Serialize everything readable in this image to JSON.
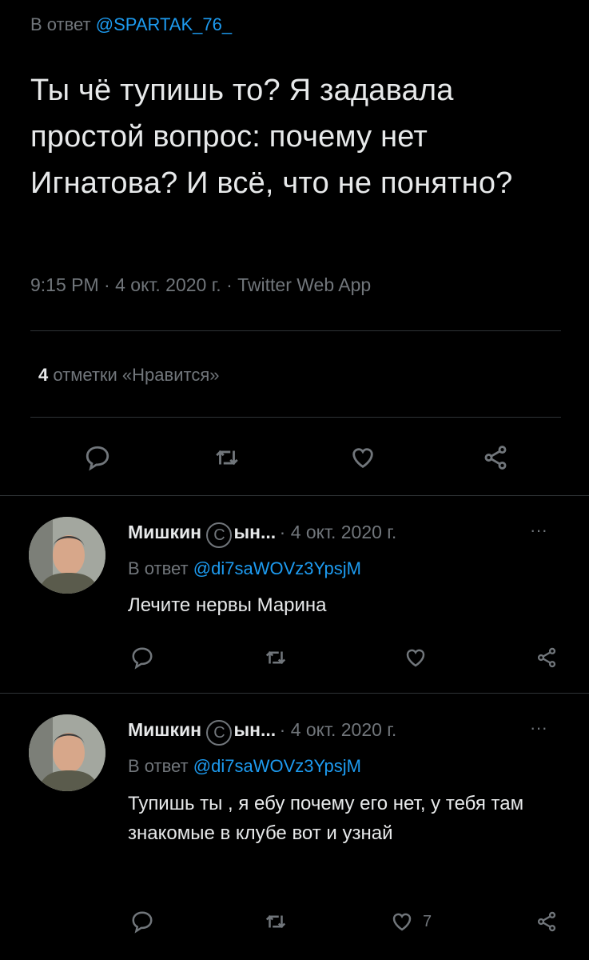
{
  "main_tweet": {
    "reply_prefix": "В ответ",
    "reply_handle": "@SPARTAK_76_",
    "text": "Ты чё тупишь то? Я задавала простой вопрос: почему нет Игнатова? И всё, что не понятно?",
    "meta": "9:15 PM · 4 окт. 2020 г. · Twitter Web App",
    "likes_count": "4",
    "likes_label": "отметки «Нравится»"
  },
  "replies": [
    {
      "name_part1": "Мишкин",
      "badge": "С",
      "name_part2": "ын...",
      "date": "· 4 окт. 2020 г.",
      "more": "···",
      "reply_prefix": "В ответ",
      "reply_handle": "@di7saWOVz3YpsjM",
      "text": "Лечите нервы Марина",
      "like_count": ""
    },
    {
      "name_part1": "Мишкин",
      "badge": "С",
      "name_part2": "ын...",
      "date": "· 4 окт. 2020 г.",
      "more": "···",
      "reply_prefix": "В ответ",
      "reply_handle": "@di7saWOVz3YpsjM",
      "text": "Тупишь ты , я ебу почему его нет, у тебя там знакомые в клубе вот и узнай",
      "like_count": "7"
    }
  ],
  "colors": {
    "background": "#000000",
    "text": "#e7e9ea",
    "muted": "#71767b",
    "link": "#1d9bf0",
    "divider": "#2f3336"
  },
  "icons": [
    "reply-icon",
    "retweet-icon",
    "like-icon",
    "share-icon",
    "more-icon"
  ]
}
